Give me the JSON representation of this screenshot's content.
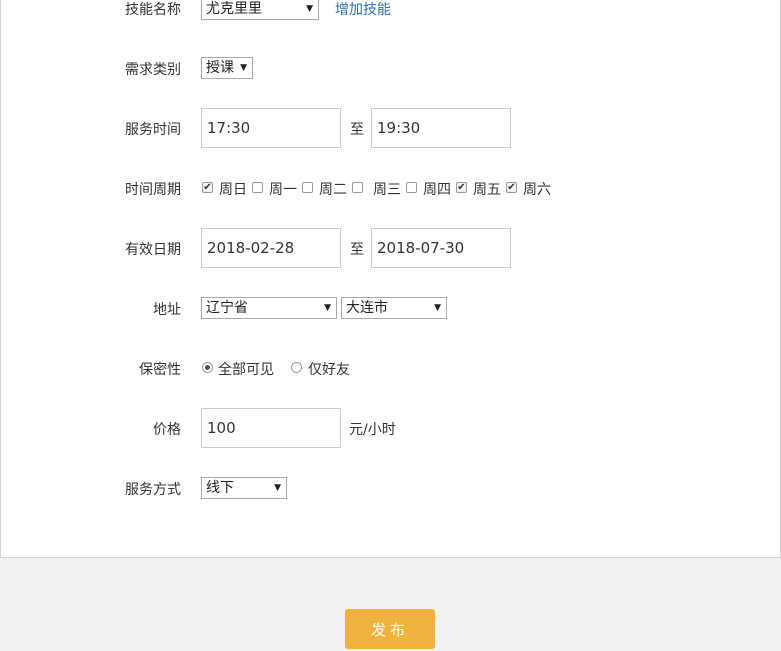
{
  "form": {
    "skill": {
      "label": "技能名称",
      "value": "尤克里里",
      "add_link": "增加技能"
    },
    "demand": {
      "label": "需求类别",
      "value": "授课"
    },
    "service_time": {
      "label": "服务时间",
      "start": "17:30",
      "sep": "至",
      "end": "19:30"
    },
    "period": {
      "label": "时间周期",
      "days": [
        {
          "label": "周日",
          "checked": true
        },
        {
          "label": "周一",
          "checked": false
        },
        {
          "label": "周二",
          "checked": false
        },
        {
          "label": "周三",
          "checked": false
        },
        {
          "label": "周四",
          "checked": false
        },
        {
          "label": "周五",
          "checked": true
        },
        {
          "label": "周六",
          "checked": true
        }
      ]
    },
    "valid_date": {
      "label": "有效日期",
      "start": "2018-02-28",
      "sep": "至",
      "end": "2018-07-30"
    },
    "address": {
      "label": "地址",
      "province": "辽宁省",
      "city": "大连市"
    },
    "privacy": {
      "label": "保密性",
      "options": [
        {
          "label": "全部可见",
          "selected": true
        },
        {
          "label": "仅好友",
          "selected": false
        }
      ]
    },
    "price": {
      "label": "价格",
      "value": "100",
      "unit": "元/小时"
    },
    "service_mode": {
      "label": "服务方式",
      "value": "线下"
    }
  },
  "actions": {
    "publish": "发布"
  }
}
